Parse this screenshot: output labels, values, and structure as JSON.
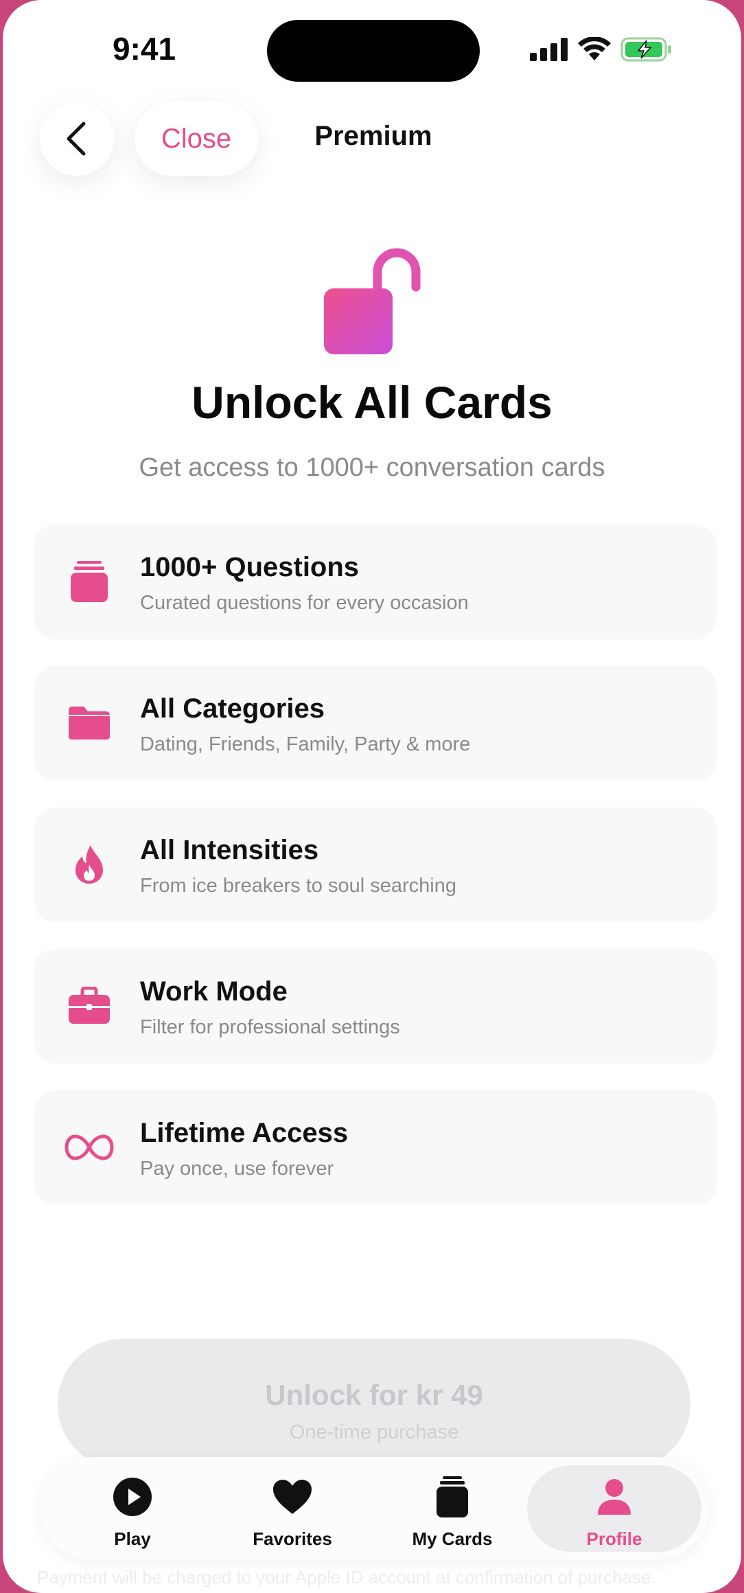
{
  "status": {
    "time": "9:41"
  },
  "nav": {
    "close_label": "Close",
    "title": "Premium"
  },
  "hero": {
    "title": "Unlock All Cards",
    "subtitle": "Get access to 1000+ conversation cards"
  },
  "features": [
    {
      "icon": "card-stack-icon",
      "title": "1000+ Questions",
      "desc": "Curated questions for every occasion"
    },
    {
      "icon": "folder-icon",
      "title": "All Categories",
      "desc": "Dating, Friends, Family, Party & more"
    },
    {
      "icon": "flame-icon",
      "title": "All Intensities",
      "desc": "From ice breakers to soul searching"
    },
    {
      "icon": "briefcase-icon",
      "title": "Work Mode",
      "desc": "Filter for professional settings"
    },
    {
      "icon": "infinity-icon",
      "title": "Lifetime Access",
      "desc": "Pay once, use forever"
    }
  ],
  "cta": {
    "title": "Unlock for kr 49",
    "subtitle": "One-time purchase"
  },
  "tabs": [
    {
      "label": "Play",
      "icon": "play-icon"
    },
    {
      "label": "Favorites",
      "icon": "heart-icon"
    },
    {
      "label": "My Cards",
      "icon": "card-stack-icon"
    },
    {
      "label": "Profile",
      "icon": "person-icon"
    }
  ],
  "fine_print": "Payment will be charged to your Apple ID account at confirmation of purchase.",
  "colors": {
    "accent": "#e54d8c",
    "accent_gradient_end": "#cf4fd6",
    "frame": "#c8467a"
  }
}
